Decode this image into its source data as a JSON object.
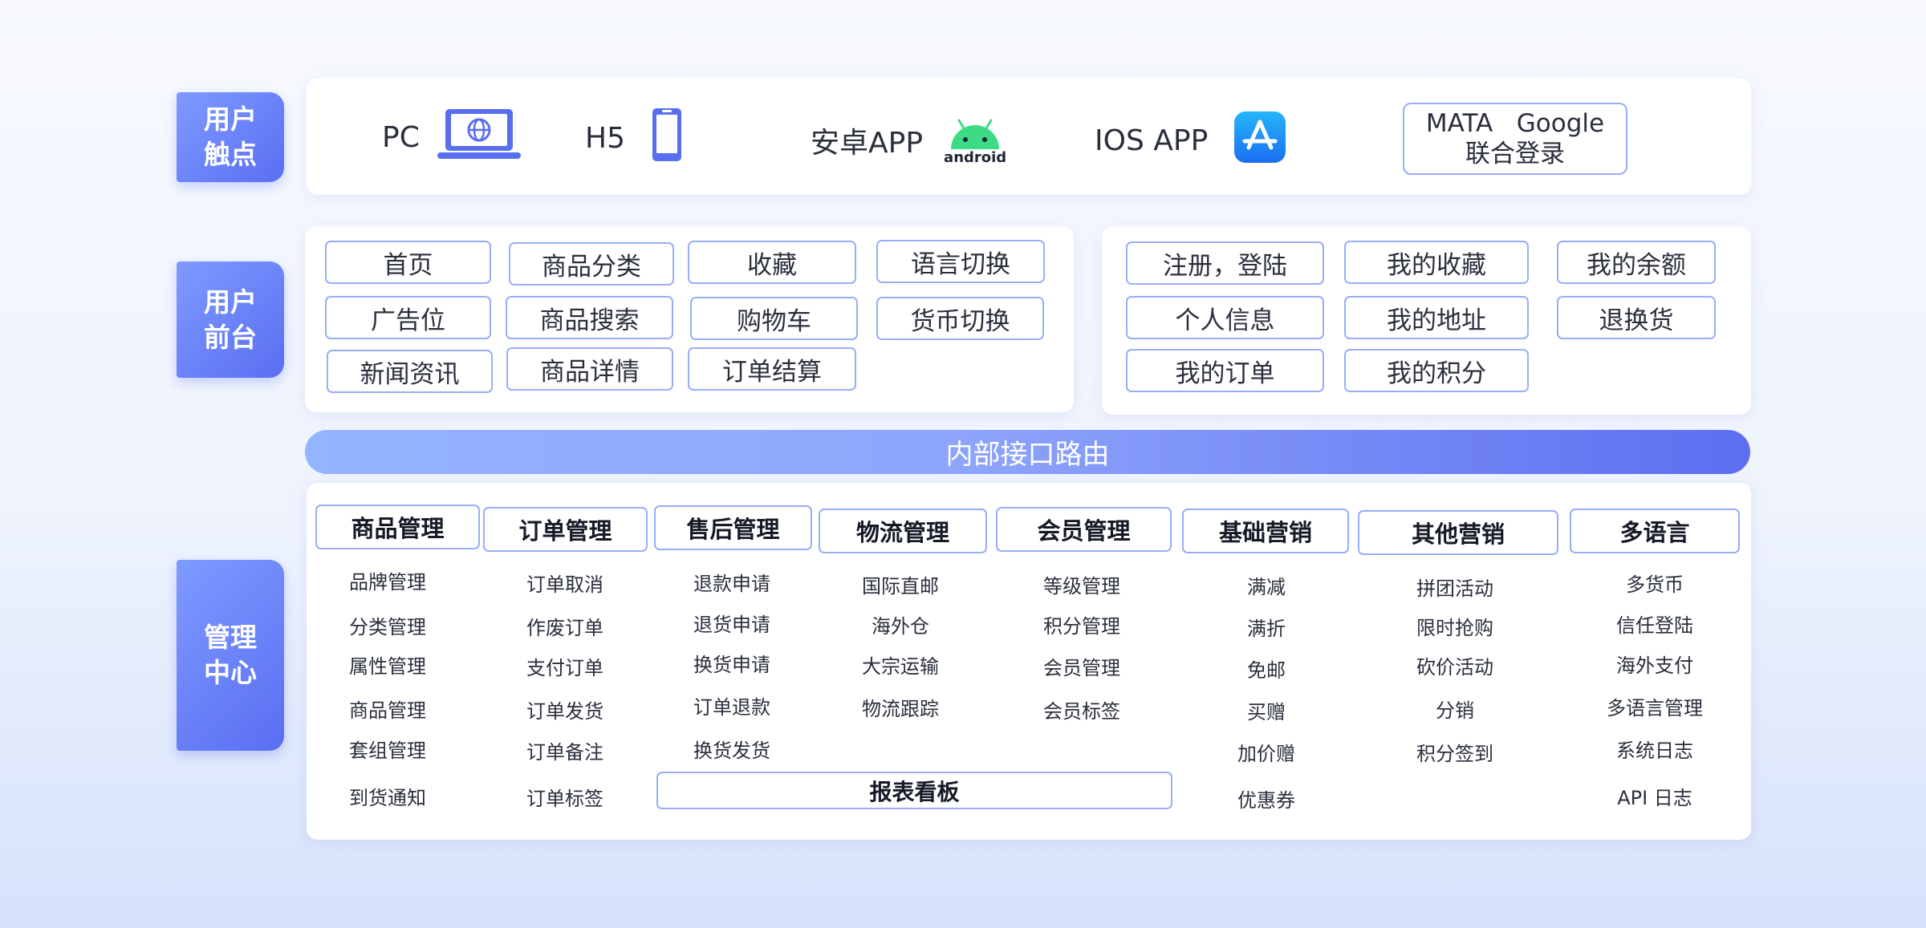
{
  "side_tabs": {
    "touch": "用户触点",
    "front": "用户前台",
    "admin": "管理中心"
  },
  "touchpoints": {
    "pc": "PC",
    "h5": "H5",
    "android": "安卓APP",
    "android_logo_text": "android",
    "ios": "IOS APP",
    "login_line1": "MATA   Google",
    "login_line2": "联合登录"
  },
  "front_left": [
    "首页",
    "商品分类",
    "收藏",
    "语言切换",
    "广告位",
    "商品搜索",
    "购物车",
    "货币切换",
    "新闻资讯",
    "商品详情",
    "订单结算"
  ],
  "front_right": [
    "注册，登陆",
    "我的收藏",
    "我的余额",
    "个人信息",
    "我的地址",
    "退换货",
    "我的订单",
    "我的积分"
  ],
  "route_bar": "内部接口路由",
  "modules": [
    {
      "title": "商品管理",
      "items": [
        "品牌管理",
        "分类管理",
        "属性管理",
        "商品管理",
        "套组管理",
        "到货通知"
      ]
    },
    {
      "title": "订单管理",
      "items": [
        "订单取消",
        "作废订单",
        "支付订单",
        "订单发货",
        "订单备注",
        "订单标签"
      ]
    },
    {
      "title": "售后管理",
      "items": [
        "退款申请",
        "退货申请",
        "换货申请",
        "订单退款",
        "换货发货"
      ]
    },
    {
      "title": "物流管理",
      "items": [
        "国际直邮",
        "海外仓",
        "大宗运输",
        "物流跟踪"
      ]
    },
    {
      "title": "会员管理",
      "items": [
        "等级管理",
        "积分管理",
        "会员管理",
        "会员标签"
      ]
    },
    {
      "title": "基础营销",
      "items": [
        "满减",
        "满折",
        "免邮",
        "买赠",
        "加价赠",
        "优惠券"
      ]
    },
    {
      "title": "其他营销",
      "items": [
        "拼团活动",
        "限时抢购",
        "砍价活动",
        "分销",
        "积分签到"
      ]
    },
    {
      "title": "多语言",
      "items": [
        "多货币",
        "信任登陆",
        "海外支付",
        "多语言管理",
        "系统日志",
        "API 日志"
      ]
    }
  ],
  "report_board": "报表看板",
  "colors": {
    "accent": "#5a6ef2",
    "border": "#97aef7",
    "android": "#3ddc84",
    "appstore": "#1a8cf0"
  }
}
